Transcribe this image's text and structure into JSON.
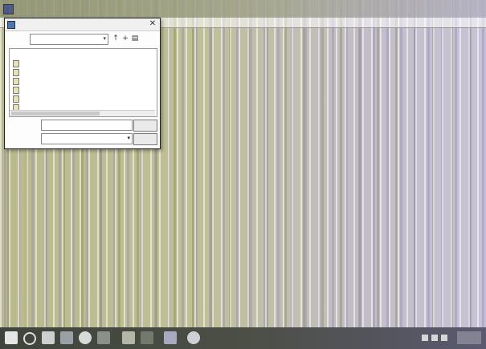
{
  "window": {
    "title": ""
  },
  "dialog": {
    "title": "",
    "look_in": {
      "label": "",
      "value": ""
    },
    "columns": {
      "name": "",
      "date": ""
    },
    "files": [
      {
        "name": "",
        "date": ""
      },
      {
        "name": "",
        "date": ""
      },
      {
        "name": "",
        "date": ""
      },
      {
        "name": "",
        "date": ""
      },
      {
        "name": "",
        "date": ""
      },
      {
        "name": "",
        "date": ""
      }
    ],
    "file_name": {
      "label": "",
      "value": ""
    },
    "file_type": {
      "label": "",
      "value": ""
    },
    "buttons": {
      "open": "",
      "cancel": ""
    }
  },
  "icons": {
    "app": "app-icon",
    "close": "close-icon",
    "up_folder": "up-folder-icon",
    "new_folder": "new-folder-icon",
    "view_menu": "view-menu-icon",
    "start": "windows-start-icon",
    "search": "search-icon",
    "file_explorer": "file-explorer-icon"
  }
}
